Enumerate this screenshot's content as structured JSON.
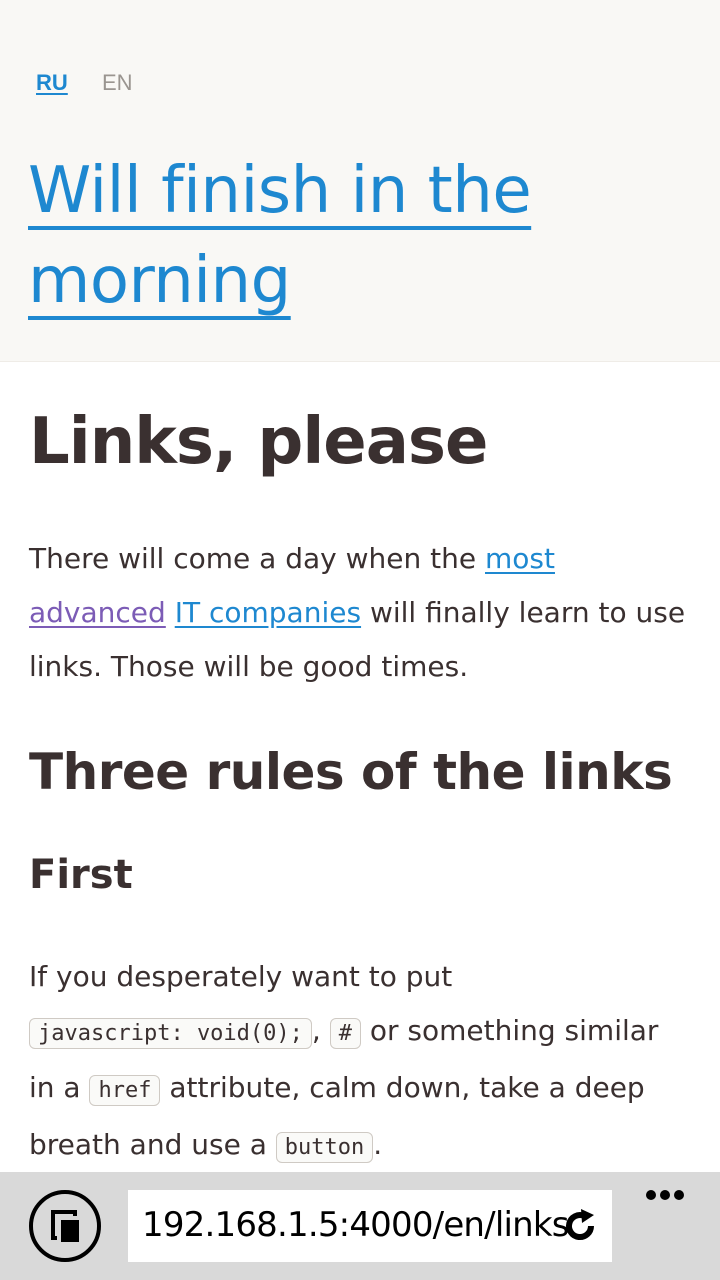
{
  "header": {
    "lang_ru": "RU",
    "lang_en": "EN",
    "site_title_line1": "Will finish in the",
    "site_title_line2": "morning"
  },
  "article": {
    "title": "Links, please",
    "intro_prefix": "There will come a day when the ",
    "link_most": "most",
    "link_advanced": "advanced",
    "link_it_companies": "IT companies",
    "intro_suffix": " will finally learn to use links. Those will be good times.",
    "rules_heading": "Three rules of the links",
    "first_heading": "First",
    "rule1_part1": "If you desperately want to put ",
    "code_void": "javascript: void(0);",
    "rule1_comma": ", ",
    "code_hash": "#",
    "rule1_part2": " or something similar in a ",
    "code_href": "href",
    "rule1_part3": " attribute, calm down, take a deep breath and use a ",
    "code_button": "button",
    "rule1_end": "."
  },
  "browser": {
    "url": "192.168.1.5:4000/en/links",
    "tabs_icon": "tabs-icon",
    "reload_icon": "reload-icon",
    "more_icon": "more-icon"
  }
}
